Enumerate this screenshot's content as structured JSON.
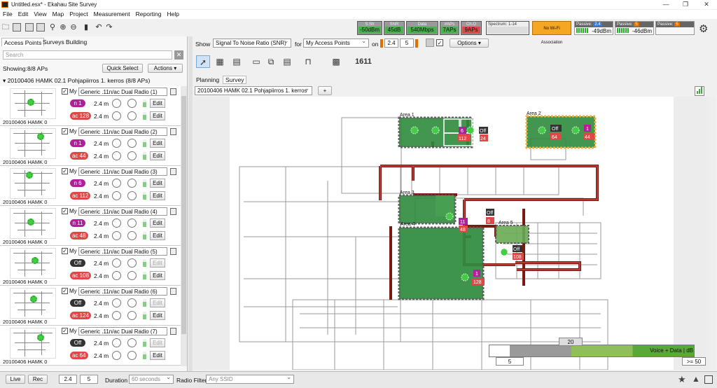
{
  "window": {
    "title": "Untitled.esx* - Ekahau Site Survey"
  },
  "menu": [
    "File",
    "Edit",
    "View",
    "Map",
    "Project",
    "Measurement",
    "Reporting",
    "Help"
  ],
  "metrics": [
    {
      "label": "S.Str",
      "value": "-50dBm",
      "status": "good"
    },
    {
      "label": "SNR",
      "value": "45dB",
      "status": "good"
    },
    {
      "label": "Data",
      "value": "540Mbps",
      "status": "good"
    },
    {
      "label": "#APs",
      "value": "7APs",
      "status": "good"
    },
    {
      "label": "Ch.O",
      "value": "9APs",
      "status": "bad"
    }
  ],
  "spectrum": "Spectrum: 1-14",
  "no_wifi": "No Wi-Fi Association",
  "passive": [
    {
      "label": "Passive:",
      "band": "2.4",
      "value": "-49dBm"
    },
    {
      "label": "Passive:",
      "band": "5",
      "value": "-46dBm"
    },
    {
      "label": "Passive:",
      "band": "5",
      "value": ""
    }
  ],
  "colors": {
    "good": "#4caf50",
    "bad": "#e04848",
    "accent": "#f5a623",
    "n_channel": "#b0209a",
    "ac_channel": "#e04848",
    "area": "#2e8b3e"
  },
  "left": {
    "tabs": [
      "Access Points",
      "Surveys",
      "Building"
    ],
    "search_placeholder": "Search",
    "showing": "Showing:8/8 APs",
    "quick_select": "Quick Select",
    "actions": "Actions",
    "group": "20100406 HAMK 02.1 Pohjapiirros 1. kerros (8/8 APs)",
    "aps": [
      {
        "thumb": "20100406 HAMK 0",
        "model": "Generic .11n/ac Dual Radio (1)",
        "my": "My",
        "ch1": "n 1",
        "ch2": "ac 128",
        "h1": "2.4 m",
        "h2": "2.4 m",
        "edit": "Edit",
        "r1on": true
      },
      {
        "thumb": "20100406 HAMK 0",
        "model": "Generic .11n/ac Dual Radio (2)",
        "my": "My",
        "ch1": "n 1",
        "ch2": "ac 44",
        "h1": "2.4 m",
        "h2": "2.4 m",
        "edit": "Edit",
        "r1on": true
      },
      {
        "thumb": "20100406 HAMK 0",
        "model": "Generic .11n/ac Dual Radio (3)",
        "my": "My",
        "ch1": "n 6",
        "ch2": "ac 112",
        "h1": "2.4 m",
        "h2": "2.4 m",
        "edit": "Edit",
        "r1on": true
      },
      {
        "thumb": "20100406 HAMK 0",
        "model": "Generic .11n/ac Dual Radio (4)",
        "my": "My",
        "ch1": "n 11",
        "ch2": "ac 48",
        "h1": "2.4 m",
        "h2": "2.4 m",
        "edit": "Edit",
        "r1on": true
      },
      {
        "thumb": "20100406 HAMK 0",
        "model": "Generic .11n/ac Dual Radio (5)",
        "my": "My",
        "ch1": "Off",
        "ch2": "ac 108",
        "h1": "2.4 m",
        "h2": "2.4 m",
        "edit": "Edit",
        "r1on": false
      },
      {
        "thumb": "20100406 HAMK 0",
        "model": "Generic .11n/ac Dual Radio (6)",
        "my": "My",
        "ch1": "Off",
        "ch2": "ac 124",
        "h1": "2.4 m",
        "h2": "2.4 m",
        "edit": "Edit",
        "r1on": false
      },
      {
        "thumb": "20100406 HAMK 0",
        "model": "Generic .11n/ac Dual Radio (7)",
        "my": "My",
        "ch1": "Off",
        "ch2": "ac 64",
        "h1": "2.4 m",
        "h2": "2.4 m",
        "edit": "Edit",
        "r1on": false
      }
    ]
  },
  "view": {
    "show_label": "Show",
    "show_value": "Signal To Noise Ratio (SNR)",
    "for_label": "for",
    "for_value": "My Access Points",
    "on_label": "on",
    "band1": "2.4",
    "band2": "5",
    "options": "Options",
    "tabs": [
      "Planning",
      "Survey"
    ],
    "map_select": "20100406 HAMK 02.1 Pohjapiirros 1. kerros",
    "add_map": "+",
    "channel_tool": "1611"
  },
  "map": {
    "areas": [
      "Area 1",
      "Area 2",
      "Area 3",
      "Area 4",
      "Area 5"
    ],
    "labels": [
      {
        "id": "a1c",
        "text": "6",
        "kind": "n"
      },
      {
        "id": "a1d",
        "text": "112",
        "kind": "ac"
      },
      {
        "id": "a1e",
        "text": "24",
        "kind": "ac"
      },
      {
        "id": "a1f",
        "text": "Off",
        "kind": "off"
      },
      {
        "id": "a2a",
        "text": "Off",
        "kind": "off"
      },
      {
        "id": "a2b",
        "text": "64",
        "kind": "ac"
      },
      {
        "id": "a2c",
        "text": "1",
        "kind": "n"
      },
      {
        "id": "a2d",
        "text": "44",
        "kind": "ac"
      },
      {
        "id": "a3a",
        "text": "11",
        "kind": "n"
      },
      {
        "id": "a3b",
        "text": "48",
        "kind": "ac"
      },
      {
        "id": "a3c",
        "text": "Off",
        "kind": "off"
      },
      {
        "id": "a3d",
        "text": "8",
        "kind": "ac"
      },
      {
        "id": "a4a",
        "text": "1",
        "kind": "n"
      },
      {
        "id": "a4b",
        "text": "128",
        "kind": "ac"
      },
      {
        "id": "a5a",
        "text": "Off",
        "kind": "off"
      },
      {
        "id": "a5b",
        "text": "108",
        "kind": "ac"
      }
    ]
  },
  "legend": {
    "top_value": "20",
    "min_value": "5",
    "max_value": ">= 50",
    "title": "Voice + Data | dB"
  },
  "status": {
    "live": "Live",
    "rec": "Rec",
    "v1": "2.4",
    "v2": "5",
    "duration_label": "Duration",
    "duration_value": "60 seconds",
    "radio_filter_label": "Radio Filter",
    "radio_filter_value": "Any SSID"
  }
}
